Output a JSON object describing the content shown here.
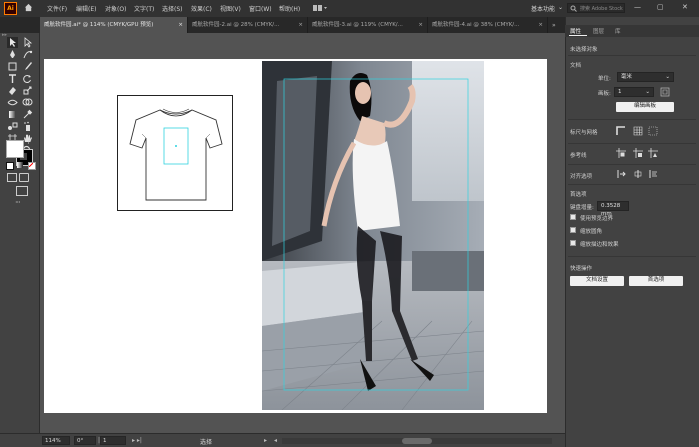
{
  "app": {
    "logo": "Ai"
  },
  "menu": [
    "文件(F)",
    "编辑(E)",
    "对象(O)",
    "文字(T)",
    "选择(S)",
    "效果(C)",
    "视图(V)",
    "窗口(W)",
    "帮助(H)"
  ],
  "workspace": {
    "label": "基本功能",
    "search_placeholder": "搜索 Adobe Stock"
  },
  "tabs": [
    {
      "label": "威航软件园.ai* @ 114% (CMYK/GPU 预览)",
      "active": true
    },
    {
      "label": "威航软件园-2.ai @ 28% (CMYK/...",
      "active": false
    },
    {
      "label": "威航软件园-3.ai @ 119% (CMYK/...",
      "active": false
    },
    {
      "label": "威航软件园-4.ai @ 38% (CMYK/...",
      "active": false
    }
  ],
  "statusbar": {
    "zoom": "114%",
    "angle": "0°",
    "artboard": "1",
    "tool": "选择"
  },
  "panel": {
    "tabs": [
      "属性",
      "图层",
      "库"
    ],
    "no_selection": "未选择对象",
    "document": "文档",
    "units_label": "单位:",
    "units_value": "毫米",
    "artboard_label": "画板:",
    "artboard_value": "1",
    "edit_artboards": "编辑画板",
    "rulers_grids": "标尺与网格",
    "guides": "参考线",
    "snap": "对齐选项",
    "preferences": "首选项",
    "keyboard_increment_label": "键盘增量:",
    "keyboard_increment_value": "0.3528 mm",
    "opt_preview_bounds": "使用预览边界",
    "opt_scale_corners": "缩放圆角",
    "opt_scale_strokes": "缩放描边和效果",
    "quick_actions": "快速操作",
    "doc_setup": "文档设置",
    "preferences_btn": "首选项"
  },
  "colors": {
    "menubar": "#323232",
    "tabbar": "#282828",
    "panel": "#424242",
    "workspace": "#535353",
    "guide": "#2fd3e0",
    "accent": "#ff7c00"
  }
}
